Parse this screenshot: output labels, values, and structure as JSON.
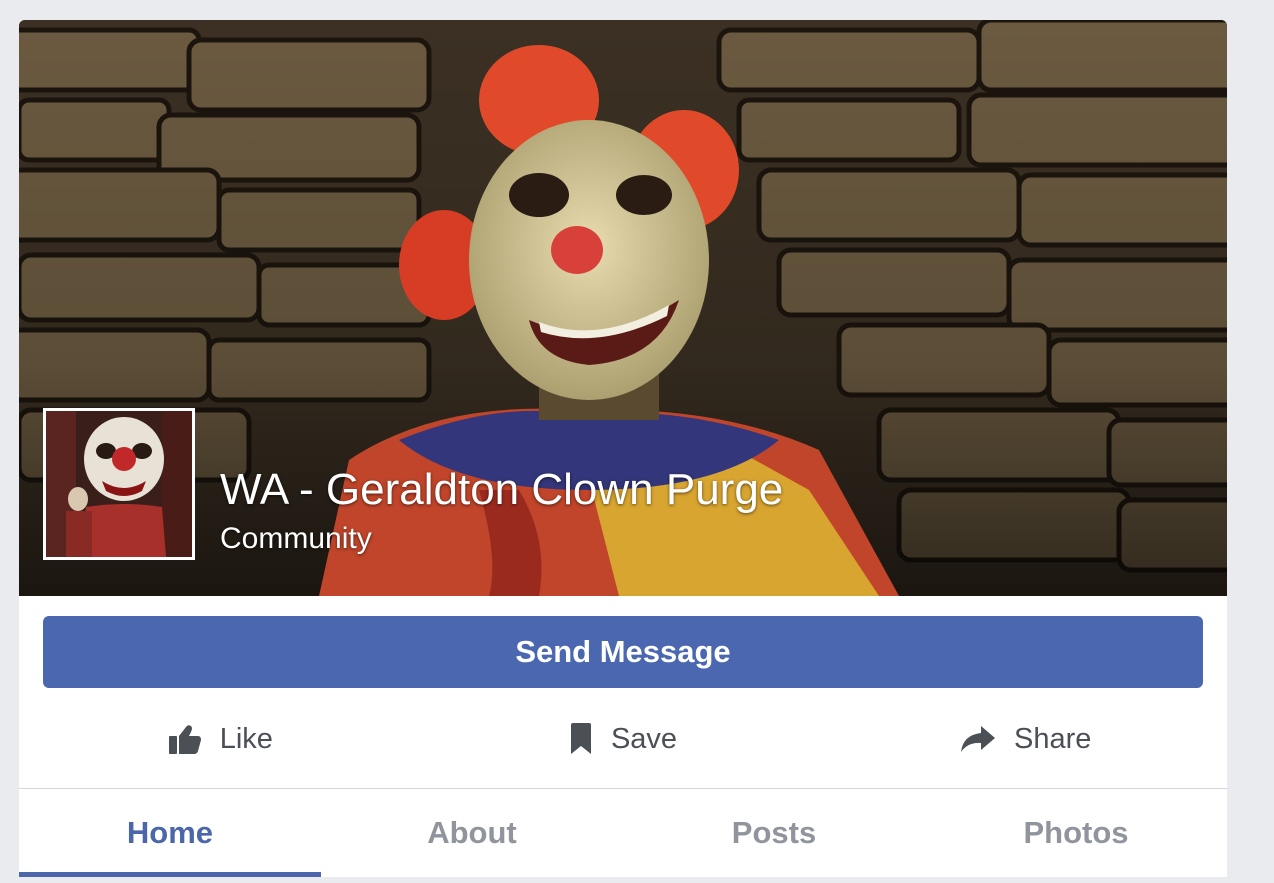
{
  "page": {
    "name": "WA - Geraldton Clown Purge",
    "category": "Community"
  },
  "primary_action": {
    "label": "Send Message"
  },
  "actions": [
    {
      "label": "Like",
      "icon": "thumbs-up-icon"
    },
    {
      "label": "Save",
      "icon": "bookmark-icon"
    },
    {
      "label": "Share",
      "icon": "share-arrow-icon"
    }
  ],
  "tabs": [
    {
      "label": "Home",
      "active": true
    },
    {
      "label": "About",
      "active": false
    },
    {
      "label": "Posts",
      "active": false
    },
    {
      "label": "Photos",
      "active": false
    }
  ],
  "colors": {
    "brand": "#4a67b0",
    "active_tab": "#4b67a9",
    "inactive_tab": "#90949c",
    "action_text": "#4b4f56",
    "background": "#e9ebee"
  }
}
